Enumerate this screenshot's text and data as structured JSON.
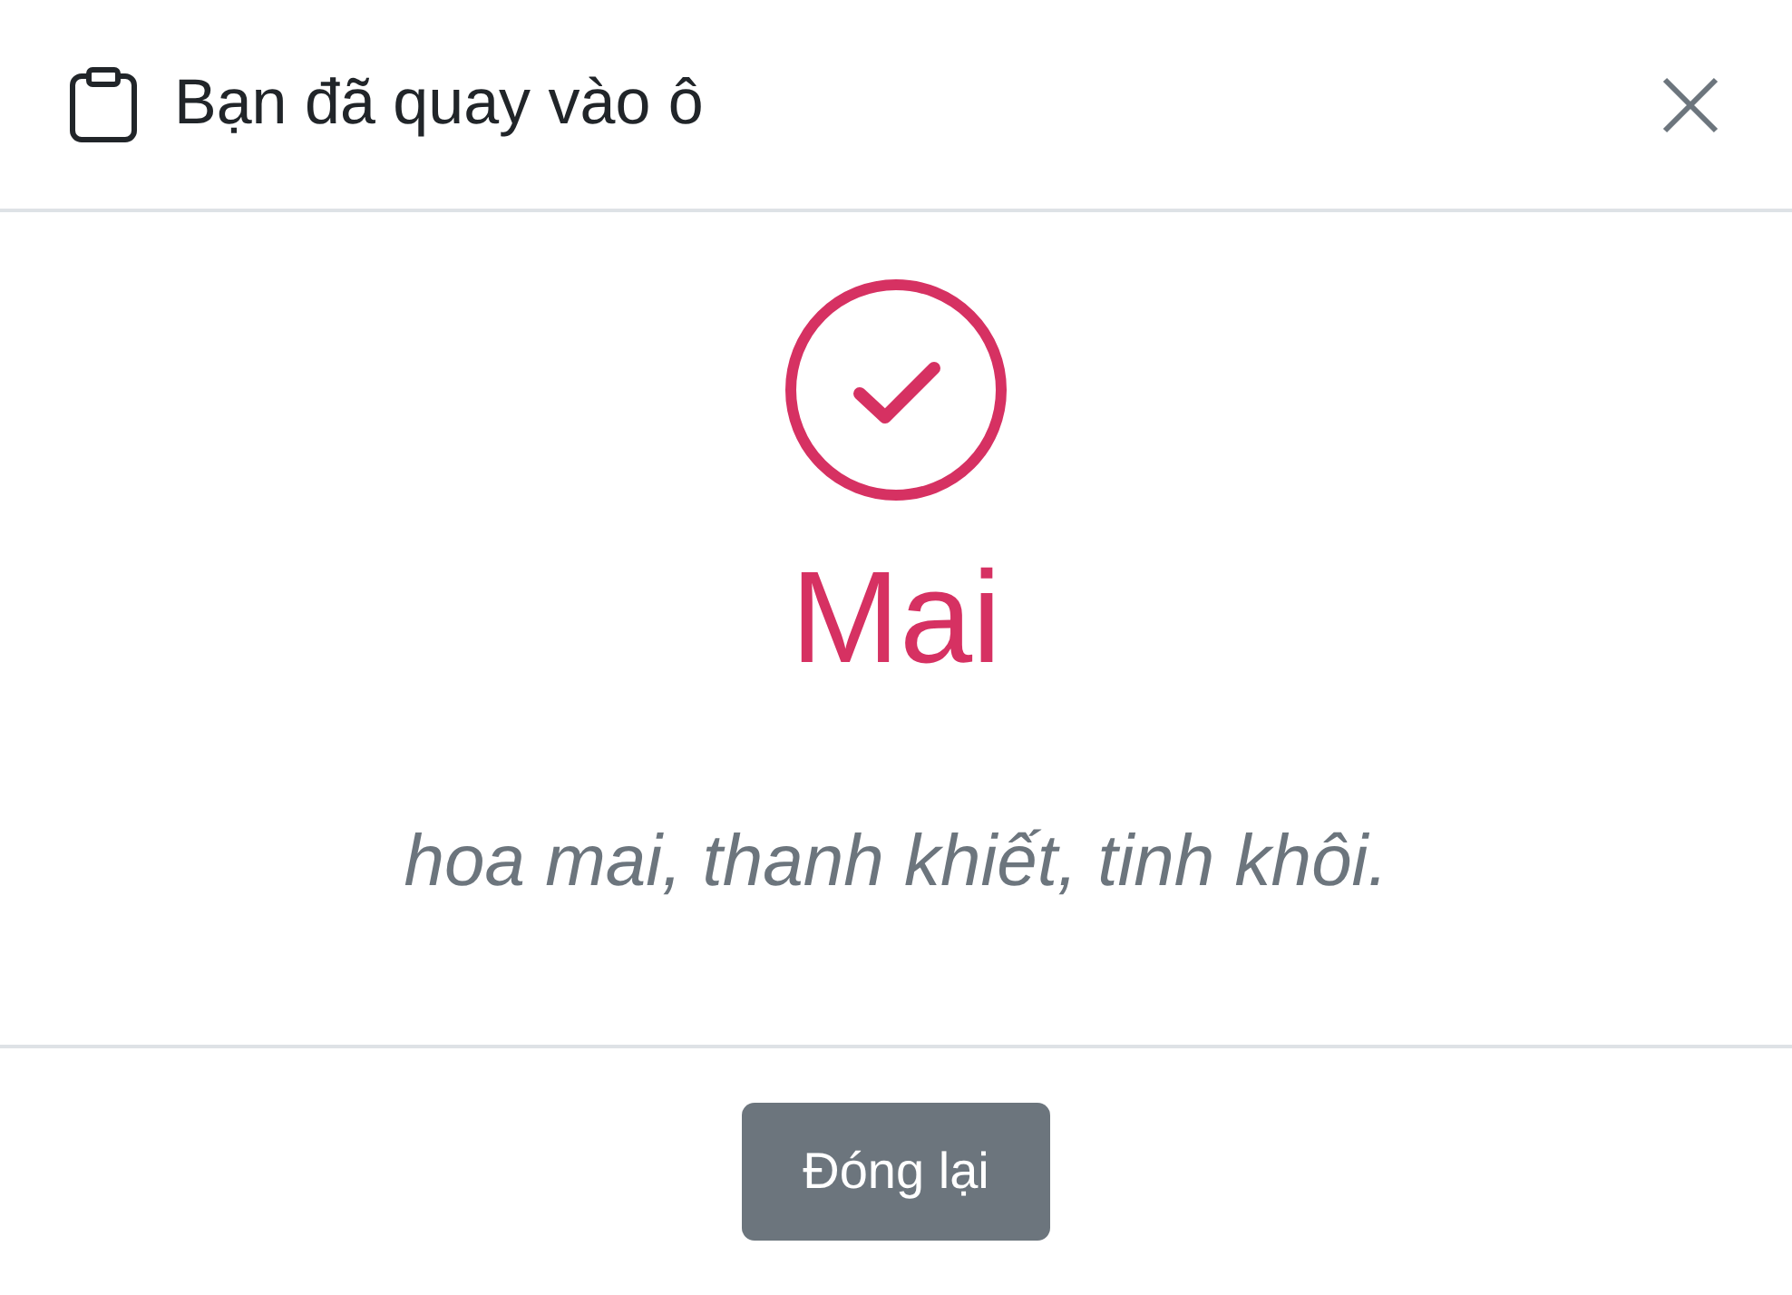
{
  "dialog": {
    "title": "Bạn đã quay vào ô"
  },
  "result": {
    "name": "Mai",
    "meaning": "hoa mai, thanh khiết, tinh khôi."
  },
  "buttons": [
    "Đóng lại"
  ]
}
